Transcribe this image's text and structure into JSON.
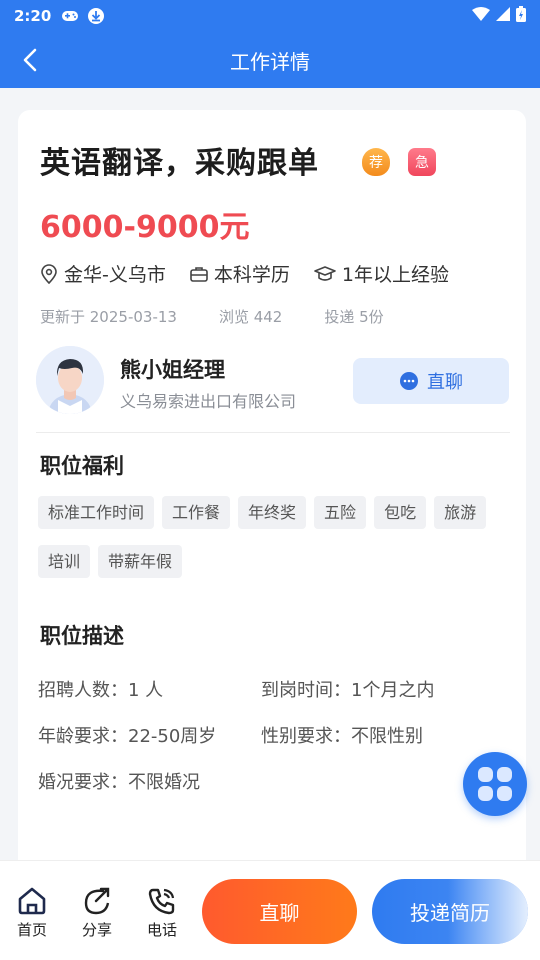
{
  "status_bar": {
    "time": "2:20"
  },
  "header": {
    "title": "工作详情"
  },
  "job": {
    "title": "英语翻译，采购跟单",
    "badge_recommended": "荐",
    "badge_urgent": "急",
    "salary": "6000-9000元",
    "location": "金华-义乌市",
    "education": "本科学历",
    "experience": "1年以上经验",
    "updated": "更新于 2025-03-13",
    "views": "浏览 442",
    "applications": "投递 5份"
  },
  "recruiter": {
    "name": "熊小姐经理",
    "company": "义乌易索进出口有限公司",
    "chat_label": "直聊"
  },
  "benefits": {
    "title": "职位福利",
    "tags": [
      "标准工作时间",
      "工作餐",
      "年终奖",
      "五险",
      "包吃",
      "旅游",
      "培训",
      "带薪年假"
    ]
  },
  "description": {
    "title": "职位描述",
    "headcount": "招聘人数：1 人",
    "start_time": "到岗时间：1个月之内",
    "age": "年龄要求：22-50周岁",
    "gender": "性别要求：不限性别",
    "marital": "婚况要求：不限婚况"
  },
  "bottom_bar": {
    "home": "首页",
    "share": "分享",
    "phone": "电话",
    "chat": "直聊",
    "apply": "投递简历"
  },
  "colors": {
    "primary": "#2f7bf0",
    "salary": "#ef4b52",
    "chat_button": "#ff6a22"
  }
}
